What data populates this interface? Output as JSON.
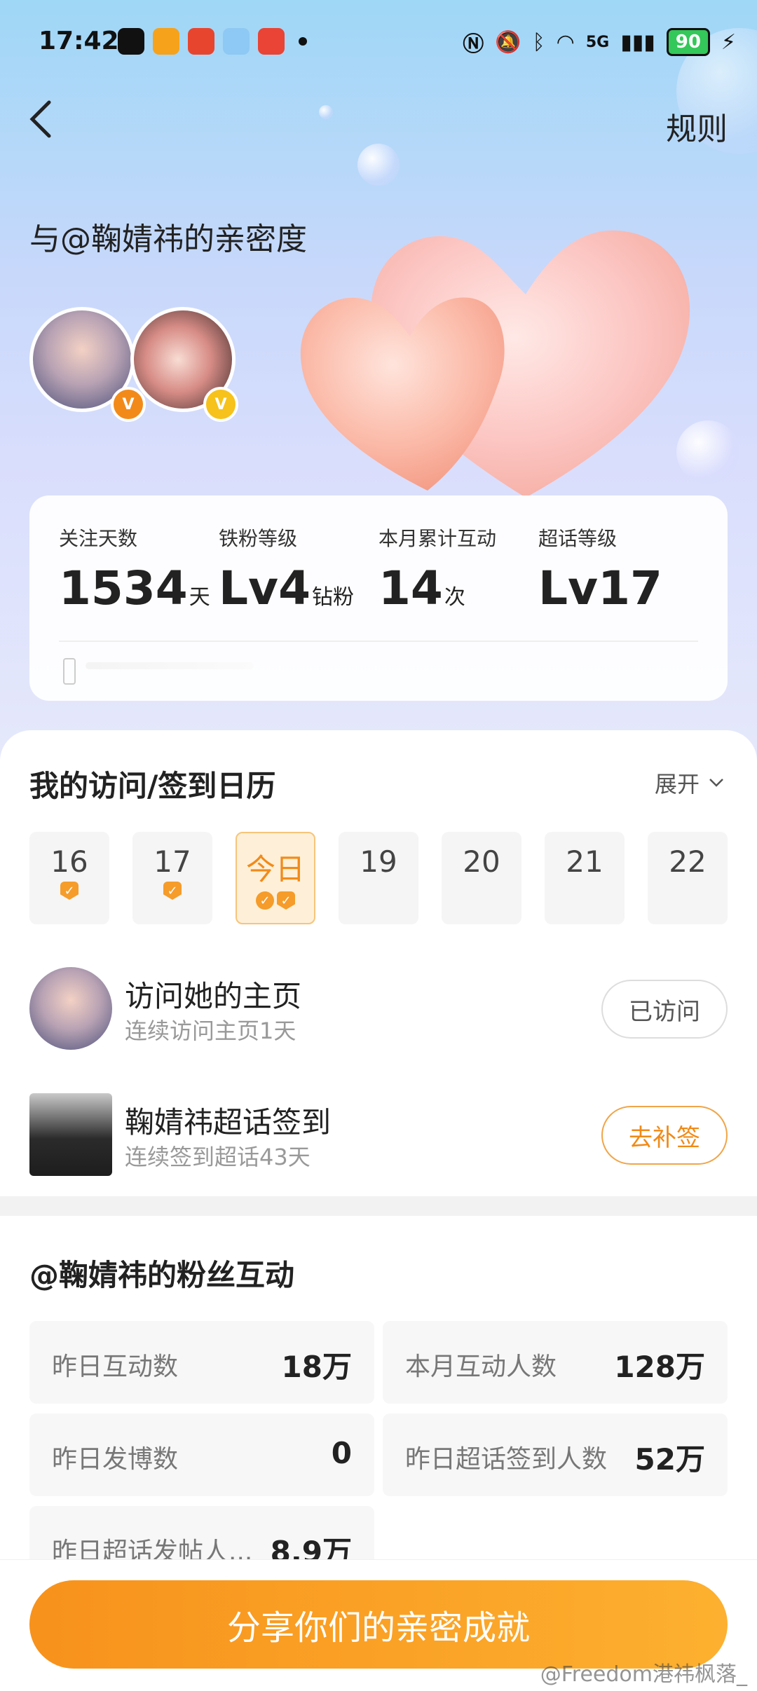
{
  "status_bar": {
    "time": "17:42",
    "network": "5G",
    "battery": "90"
  },
  "nav": {
    "rules_label": "规则"
  },
  "header": {
    "title": "与@鞠婧祎的亲密度"
  },
  "stats": [
    {
      "label": "关注天数",
      "value": "1534",
      "unit": "天"
    },
    {
      "label": "铁粉等级",
      "value": "Lv4",
      "unit": "钻粉"
    },
    {
      "label": "本月累计互动",
      "value": "14",
      "unit": "次"
    },
    {
      "label": "超话等级",
      "value": "Lv17",
      "unit": ""
    }
  ],
  "calendar": {
    "title": "我的访问/签到日历",
    "expand_label": "展开",
    "days": [
      {
        "label": "16",
        "marks": 1
      },
      {
        "label": "17",
        "marks": 1
      },
      {
        "label": "今日",
        "marks": 2
      },
      {
        "label": "19",
        "marks": 0
      },
      {
        "label": "20",
        "marks": 0
      },
      {
        "label": "21",
        "marks": 0
      },
      {
        "label": "22",
        "marks": 0
      }
    ]
  },
  "tasks": [
    {
      "title": "访问她的主页",
      "subtitle": "连续访问主页1天",
      "button": "已访问"
    },
    {
      "title": "鞠婧祎超话签到",
      "subtitle": "连续签到超话43天",
      "button": "去补签"
    }
  ],
  "fans": {
    "title": "@鞠婧祎的粉丝互动",
    "items": [
      {
        "label": "昨日互动数",
        "value": "18万"
      },
      {
        "label": "本月互动人数",
        "value": "128万"
      },
      {
        "label": "昨日发博数",
        "value": "0"
      },
      {
        "label": "昨日超话签到人数",
        "value": "52万"
      },
      {
        "label": "昨日超话发帖人...",
        "value": "8.9万"
      }
    ]
  },
  "share": {
    "label": "分享你们的亲密成就"
  },
  "watermark": "@Freedom港祎枫落_",
  "colors": {
    "accent": "#f7921c",
    "badge_orange": "#f28a1a",
    "badge_yellow": "#f6c21b"
  }
}
